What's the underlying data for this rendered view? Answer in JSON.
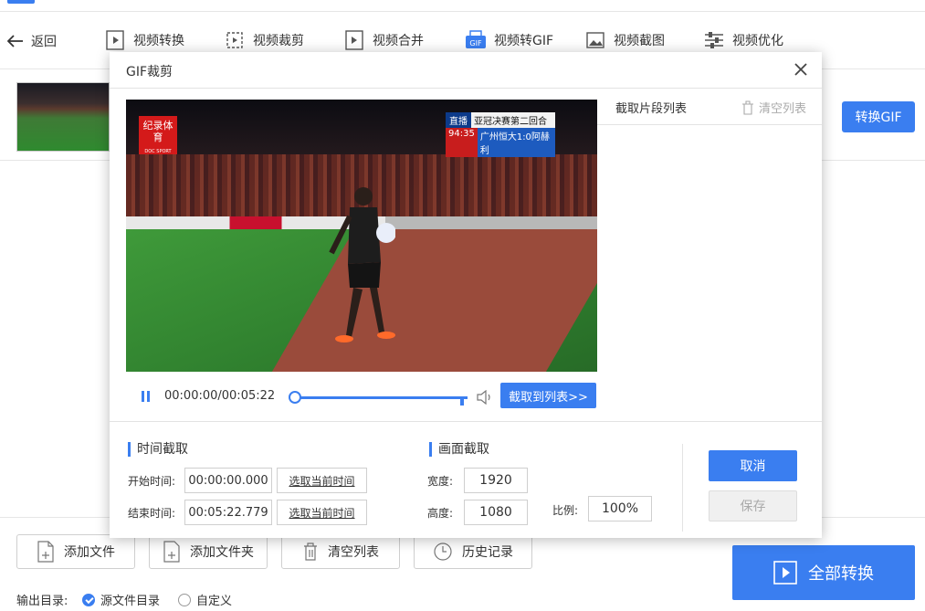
{
  "header": {
    "back_label": "返回",
    "tools": [
      {
        "label": "视频转换",
        "icon": "video-convert-icon"
      },
      {
        "label": "视频裁剪",
        "icon": "video-crop-icon"
      },
      {
        "label": "视频合并",
        "icon": "video-merge-icon"
      },
      {
        "label": "视频转GIF",
        "icon": "gif-icon"
      },
      {
        "label": "视频截图",
        "icon": "screenshot-icon"
      },
      {
        "label": "视频优化",
        "icon": "optimize-icon"
      }
    ]
  },
  "file_row": {
    "convert_gif_label": "转换GIF"
  },
  "bottom": {
    "add_file": "添加文件",
    "add_folder": "添加文件夹",
    "clear_list": "清空列表",
    "history": "历史记录",
    "output_label": "输出目录:",
    "option_source": "源文件目录",
    "option_custom": "自定义",
    "selected_option": "源文件目录",
    "convert_all": "全部转换"
  },
  "dialog": {
    "title": "GIF裁剪",
    "video": {
      "logo_text": "纪录体育",
      "logo_sub": "DOC SPORT",
      "live": "直播",
      "competition": "亚冠决赛第二回合",
      "match_time": "94:35",
      "match_result": "广州恒大1:0阿赫利"
    },
    "player": {
      "timecode": "00:00:00/00:05:22",
      "progress": 0.0,
      "clip_button": "截取到列表>>"
    },
    "segments": {
      "title": "截取片段列表",
      "clear_label": "清空列表"
    },
    "time_section": {
      "title": "时间截取",
      "start_label": "开始时间:",
      "start_value": "00:00:00.000",
      "end_label": "结束时间:",
      "end_value": "00:05:22.779",
      "pick_current": "选取当前时间"
    },
    "frame_section": {
      "title": "画面截取",
      "width_label": "宽度:",
      "width_value": "1920",
      "height_label": "高度:",
      "height_value": "1080",
      "ratio_label": "比例:",
      "ratio_value": "100%"
    },
    "cancel_label": "取消",
    "save_label": "保存"
  },
  "colors": {
    "accent": "#3a7ef0",
    "disabled": "#aaaaaa"
  }
}
